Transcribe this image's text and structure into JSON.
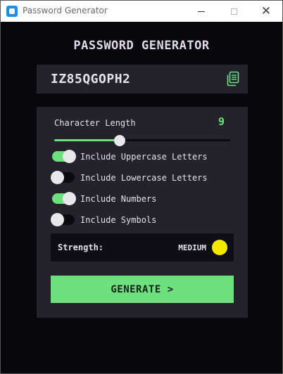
{
  "window": {
    "title": "Password Generator",
    "icons": {
      "app": "app-icon",
      "minimize": "minimize-icon",
      "maximize": "maximize-icon",
      "close": "close-icon"
    }
  },
  "header": {
    "title": "PASSWORD GENERATOR"
  },
  "password": {
    "value": "IZ85QGOPH2",
    "copy_icon": "copy-icon"
  },
  "length": {
    "label": "Character Length",
    "value": "9",
    "slider_fraction": 0.37
  },
  "options": [
    {
      "label": "Include Uppercase Letters",
      "checked": true
    },
    {
      "label": "Include Lowercase Letters",
      "checked": false
    },
    {
      "label": "Include Numbers",
      "checked": true
    },
    {
      "label": "Include Symbols",
      "checked": false
    }
  ],
  "strength": {
    "label": "Strength:",
    "value": "MEDIUM",
    "color": "#f5e800"
  },
  "generate": {
    "label": "GENERATE >"
  },
  "colors": {
    "accent": "#6ee07e",
    "background": "#08070b",
    "panel": "#24232b"
  }
}
